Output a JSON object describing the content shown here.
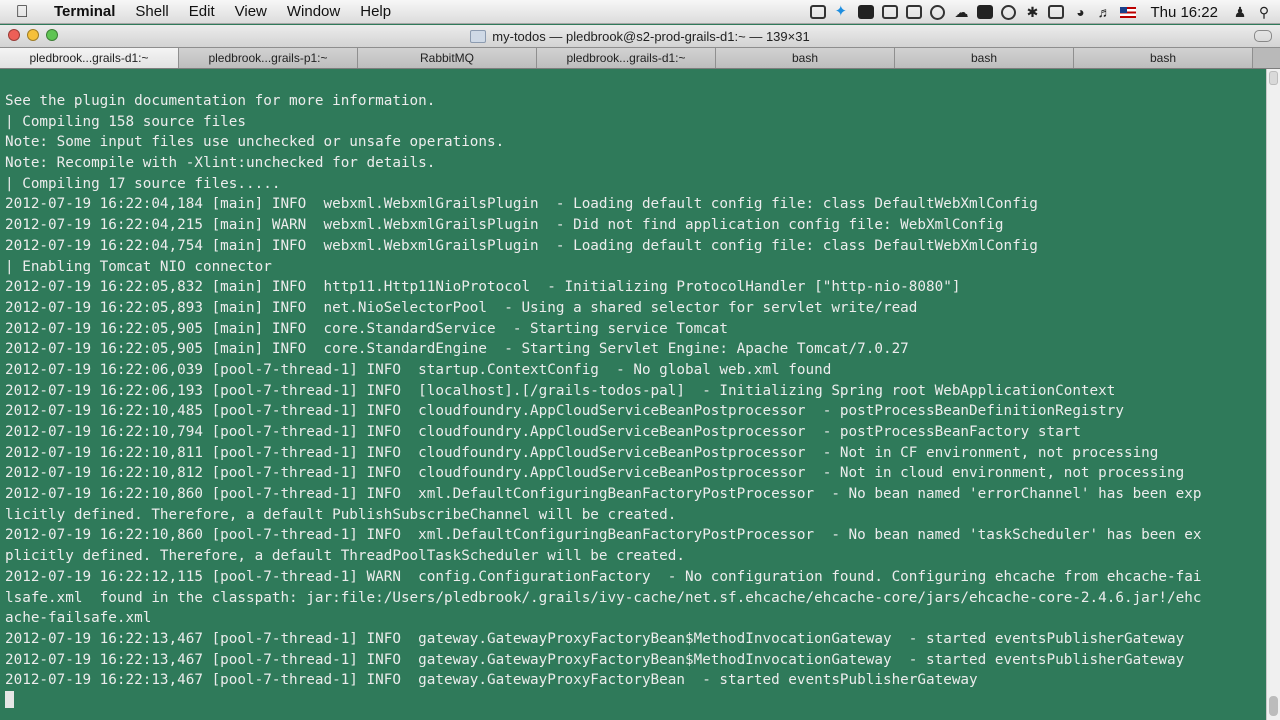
{
  "menubar": {
    "apple": "",
    "app_name": "Terminal",
    "items": [
      "Shell",
      "Edit",
      "View",
      "Window",
      "Help"
    ],
    "status_icons": [
      "camera-icon",
      "twitter-icon",
      "shield-icon",
      "layers-icon",
      "crop-icon",
      "network-icon",
      "cloud-icon",
      "battery-meter-icon",
      "clock-icon",
      "bluetooth-icon",
      "display-icon",
      "wifi-icon",
      "volume-icon",
      "us-flag-icon"
    ],
    "clock": "Thu 16:22",
    "user_icon": "user-icon",
    "spotlight_icon": "search-icon"
  },
  "window": {
    "title": "my-todos — pledbrook@s2-prod-grails-d1:~ — 139×31"
  },
  "tabs": [
    {
      "label": "pledbrook...grails-d1:~",
      "active": true
    },
    {
      "label": "pledbrook...grails-p1:~",
      "active": false
    },
    {
      "label": "RabbitMQ",
      "active": false
    },
    {
      "label": "pledbrook...grails-d1:~",
      "active": false
    },
    {
      "label": "bash",
      "active": false
    },
    {
      "label": "bash",
      "active": false
    },
    {
      "label": "bash",
      "active": false
    }
  ],
  "terminal": {
    "lines": [
      "See the plugin documentation for more information.",
      "| Compiling 158 source files",
      "Note: Some input files use unchecked or unsafe operations.",
      "Note: Recompile with -Xlint:unchecked for details.",
      "| Compiling 17 source files.....",
      "2012-07-19 16:22:04,184 [main] INFO  webxml.WebxmlGrailsPlugin  - Loading default config file: class DefaultWebXmlConfig",
      "2012-07-19 16:22:04,215 [main] WARN  webxml.WebxmlGrailsPlugin  - Did not find application config file: WebXmlConfig",
      "2012-07-19 16:22:04,754 [main] INFO  webxml.WebxmlGrailsPlugin  - Loading default config file: class DefaultWebXmlConfig",
      "| Enabling Tomcat NIO connector",
      "2012-07-19 16:22:05,832 [main] INFO  http11.Http11NioProtocol  - Initializing ProtocolHandler [\"http-nio-8080\"]",
      "2012-07-19 16:22:05,893 [main] INFO  net.NioSelectorPool  - Using a shared selector for servlet write/read",
      "2012-07-19 16:22:05,905 [main] INFO  core.StandardService  - Starting service Tomcat",
      "2012-07-19 16:22:05,905 [main] INFO  core.StandardEngine  - Starting Servlet Engine: Apache Tomcat/7.0.27",
      "2012-07-19 16:22:06,039 [pool-7-thread-1] INFO  startup.ContextConfig  - No global web.xml found",
      "2012-07-19 16:22:06,193 [pool-7-thread-1] INFO  [localhost].[/grails-todos-pal]  - Initializing Spring root WebApplicationContext",
      "2012-07-19 16:22:10,485 [pool-7-thread-1] INFO  cloudfoundry.AppCloudServiceBeanPostprocessor  - postProcessBeanDefinitionRegistry",
      "2012-07-19 16:22:10,794 [pool-7-thread-1] INFO  cloudfoundry.AppCloudServiceBeanPostprocessor  - postProcessBeanFactory start",
      "2012-07-19 16:22:10,811 [pool-7-thread-1] INFO  cloudfoundry.AppCloudServiceBeanPostprocessor  - Not in CF environment, not processing",
      "2012-07-19 16:22:10,812 [pool-7-thread-1] INFO  cloudfoundry.AppCloudServiceBeanPostprocessor  - Not in cloud environment, not processing",
      "2012-07-19 16:22:10,860 [pool-7-thread-1] INFO  xml.DefaultConfiguringBeanFactoryPostProcessor  - No bean named 'errorChannel' has been exp",
      "licitly defined. Therefore, a default PublishSubscribeChannel will be created.",
      "2012-07-19 16:22:10,860 [pool-7-thread-1] INFO  xml.DefaultConfiguringBeanFactoryPostProcessor  - No bean named 'taskScheduler' has been ex",
      "plicitly defined. Therefore, a default ThreadPoolTaskScheduler will be created.",
      "2012-07-19 16:22:12,115 [pool-7-thread-1] WARN  config.ConfigurationFactory  - No configuration found. Configuring ehcache from ehcache-fai",
      "lsafe.xml  found in the classpath: jar:file:/Users/pledbrook/.grails/ivy-cache/net.sf.ehcache/ehcache-core/jars/ehcache-core-2.4.6.jar!/ehc",
      "ache-failsafe.xml",
      "2012-07-19 16:22:13,467 [pool-7-thread-1] INFO  gateway.GatewayProxyFactoryBean$MethodInvocationGateway  - started eventsPublisherGateway",
      "2012-07-19 16:22:13,467 [pool-7-thread-1] INFO  gateway.GatewayProxyFactoryBean$MethodInvocationGateway  - started eventsPublisherGateway",
      "2012-07-19 16:22:13,467 [pool-7-thread-1] INFO  gateway.GatewayProxyFactoryBean  - started eventsPublisherGateway"
    ]
  }
}
